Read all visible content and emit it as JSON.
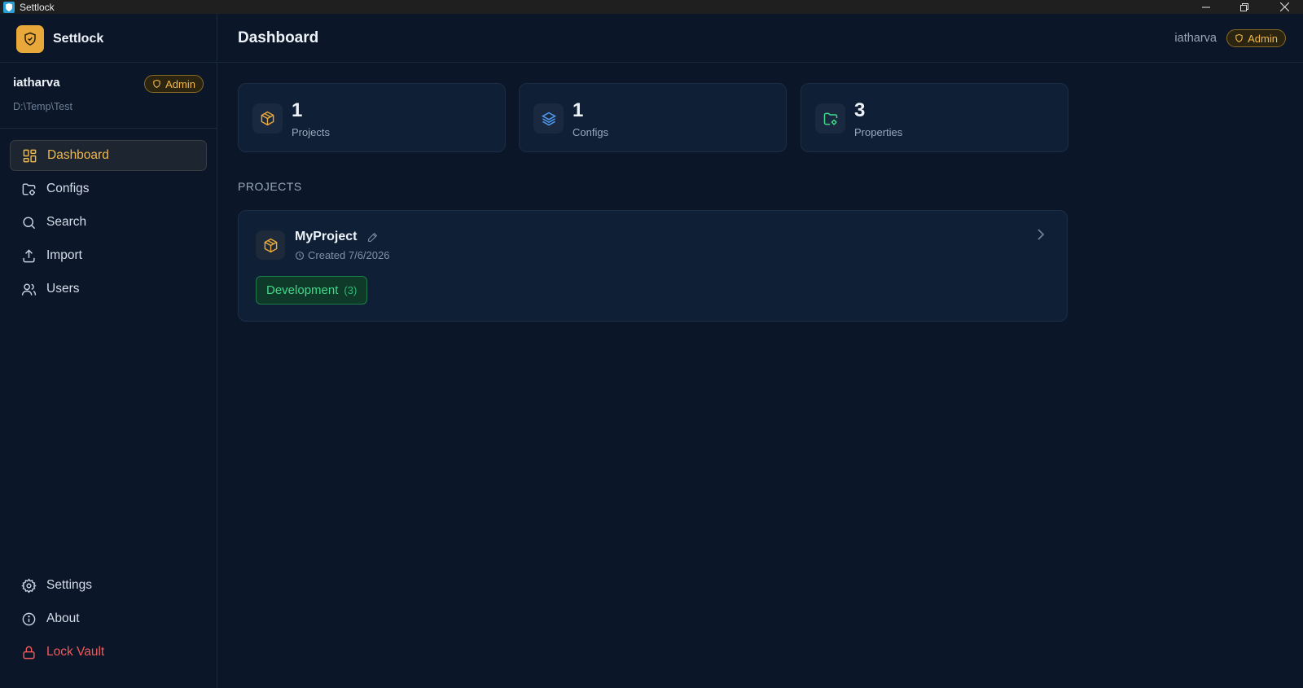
{
  "window": {
    "title": "Settlock"
  },
  "brand": {
    "name": "Settlock"
  },
  "user": {
    "name": "iatharva",
    "role": "Admin",
    "vault_path": "D:\\Temp\\Test"
  },
  "nav": {
    "items": [
      {
        "label": "Dashboard",
        "icon": "grid-icon",
        "active": true
      },
      {
        "label": "Configs",
        "icon": "folder-icon"
      },
      {
        "label": "Search",
        "icon": "search-icon"
      },
      {
        "label": "Import",
        "icon": "upload-icon"
      },
      {
        "label": "Users",
        "icon": "users-icon"
      }
    ],
    "bottom": [
      {
        "label": "Settings",
        "icon": "gear-icon"
      },
      {
        "label": "About",
        "icon": "info-icon"
      },
      {
        "label": "Lock Vault",
        "icon": "lock-icon"
      }
    ]
  },
  "header": {
    "title": "Dashboard",
    "user": "iatharva",
    "role": "Admin"
  },
  "stats": [
    {
      "value": "1",
      "label": "Projects",
      "icon": "box-icon",
      "color": "#e9a93a"
    },
    {
      "value": "1",
      "label": "Configs",
      "icon": "layers-icon",
      "color": "#4d9cf0"
    },
    {
      "value": "3",
      "label": "Properties",
      "icon": "folder-icon",
      "color": "#3fd98a"
    }
  ],
  "projects_section": {
    "title": "PROJECTS"
  },
  "projects": [
    {
      "name": "MyProject",
      "created": "Created 7/6/2026",
      "environments": [
        {
          "name": "Development",
          "count": "(3)"
        }
      ]
    }
  ],
  "colors": {
    "accent": "#f2b84a",
    "background": "#0b1628",
    "card": "#0f1f36",
    "danger": "#f05a5a",
    "success": "#3fd98a"
  }
}
